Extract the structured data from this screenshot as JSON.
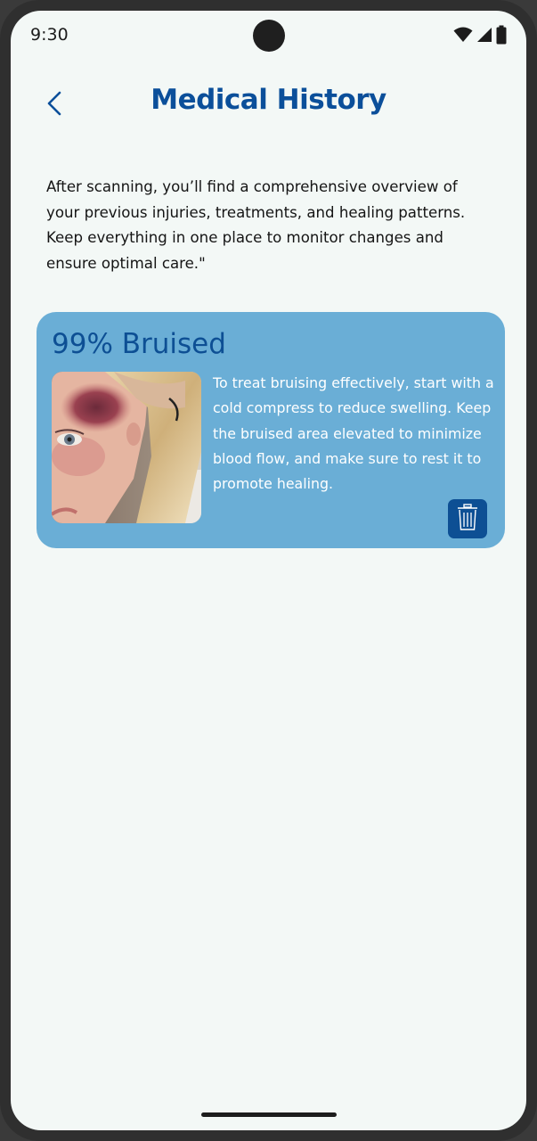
{
  "status_bar": {
    "time": "9:30",
    "icons": [
      "wifi-icon",
      "signal-icon",
      "battery-icon"
    ]
  },
  "header": {
    "back_icon": "chevron-left-icon",
    "title": "Medical History"
  },
  "intro": {
    "text": "After scanning, you’ll find a comprehensive overview of your previous injuries, treatments, and healing patterns. Keep everything in one place to monitor changes and ensure optimal care.\""
  },
  "history_items": [
    {
      "title": "99% Bruised",
      "image_icon": "bruise-photo",
      "description": "To treat bruising effectively, start with a cold compress to reduce swelling. Keep the bruised area elevated to minimize blood flow, and make sure to rest it to promote healing.",
      "delete_icon": "trash-icon"
    }
  ],
  "colors": {
    "background": "#f3f8f6",
    "primary": "#0b4f9a",
    "card": "#6aaed6",
    "card_text": "#ffffff"
  }
}
